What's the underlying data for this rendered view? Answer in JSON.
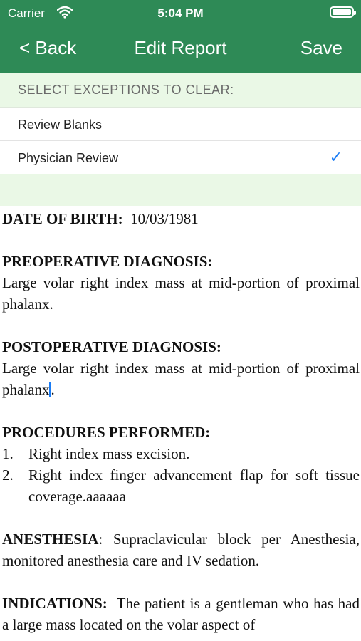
{
  "status_bar": {
    "carrier": "Carrier",
    "time": "5:04 PM",
    "battery_level": 1.0
  },
  "nav": {
    "back_label": "< Back",
    "title": "Edit Report",
    "save_label": "Save"
  },
  "exceptions": {
    "header": "SELECT EXCEPTIONS TO CLEAR:",
    "items": [
      {
        "label": "Review Blanks",
        "checked": false
      },
      {
        "label": "Physician Review",
        "checked": true
      }
    ],
    "check_glyph": "✓"
  },
  "report": {
    "dob_label": "DATE OF BIRTH:",
    "dob_value": "10/03/1981",
    "preop_heading": "PREOPERATIVE DIAGNOSIS:",
    "preop_text": "Large volar right index mass at mid-portion of proximal phalanx.",
    "postop_heading": "POSTOPERATIVE DIAGNOSIS:",
    "postop_text_before_cursor": "Large volar right index mass at mid-portion of proximal phalanx",
    "postop_text_after_cursor": ".",
    "procedures_heading": "PROCEDURES PERFORMED:",
    "procedures": [
      {
        "num": "1.",
        "text": "Right index mass excision."
      },
      {
        "num": "2.",
        "text": "Right index finger advancement flap for soft tissue coverage.aaaaaa"
      }
    ],
    "anesthesia_label": "ANESTHESIA",
    "anesthesia_text": ":  Supraclavicular block per Anesthesia, monitored anesthesia care and IV sedation.",
    "indications_label": "INDICATIONS:",
    "indications_text": "The patient is a gentleman who has had a large mass located on the volar aspect of"
  },
  "colors": {
    "nav_bar": "#2e8a56",
    "section_background": "#eaf8e6",
    "checkmark": "#1a7cf5"
  }
}
